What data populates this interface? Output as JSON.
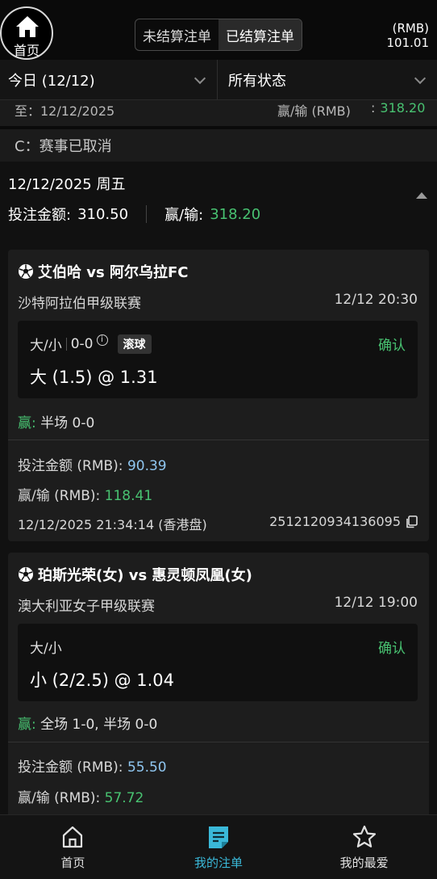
{
  "header": {
    "home_label": "首页",
    "tabs": [
      "未结算注单",
      "已结算注单"
    ],
    "active_tab": 1,
    "currency": "(RMB)",
    "balance": "101.01"
  },
  "filters": {
    "date": "今日 (12/12)",
    "status": "所有状态"
  },
  "summary_partial": {
    "to_label": "至：12/12/2025",
    "winloss_label": "赢/输 (RMB)",
    "colon": ":",
    "winloss_value": "318.20"
  },
  "cancel_note": "C：赛事已取消",
  "day_summary": {
    "date": "12/12/2025 周五",
    "stake_label": "投注金额:",
    "stake_value": "310.50",
    "winloss_label": "赢/输:",
    "winloss_value": "318.20"
  },
  "bets": [
    {
      "match": "艾伯哈 vs 阿尔乌拉FC",
      "league": "沙特阿拉伯甲级联赛",
      "kickoff": "12/12 20:30",
      "market": "大/小",
      "score": "0-0",
      "info_icon": "i",
      "live_tag": "滚球",
      "status": "确认",
      "selection": "大 (1.5) @ 1.31",
      "result_prefix": "赢:",
      "result_text": " 半场 0-0",
      "stake_label": "投注金额 (RMB):",
      "stake_value": "90.39",
      "winloss_label": "赢/输 (RMB):",
      "winloss_value": "118.41",
      "bet_time": "12/12/2025 21:34:14 (香港盘)",
      "ref_no": "2512120934136095"
    },
    {
      "match": "珀斯光荣(女) vs 惠灵顿凤凰(女)",
      "league": "澳大利亚女子甲级联赛",
      "kickoff": "12/12 19:00",
      "market": "大/小",
      "status": "确认",
      "selection": "小 (2/2.5) @ 1.04",
      "result_prefix": "赢:",
      "result_text": " 全场 1-0, 半场 0-0",
      "stake_label": "投注金额 (RMB):",
      "stake_value": "55.50",
      "winloss_label": "赢/输 (RMB):",
      "winloss_value": "57.72"
    }
  ],
  "bottom_nav": [
    {
      "label": "首页",
      "icon": "home-icon"
    },
    {
      "label": "我的注单",
      "icon": "bet-slip-icon",
      "active": true
    },
    {
      "label": "我的最爱",
      "icon": "star-icon"
    }
  ],
  "colors": {
    "accent": "#3ab8d8",
    "win": "#48c271",
    "stake": "#8fc6f0",
    "background": "#111111"
  }
}
